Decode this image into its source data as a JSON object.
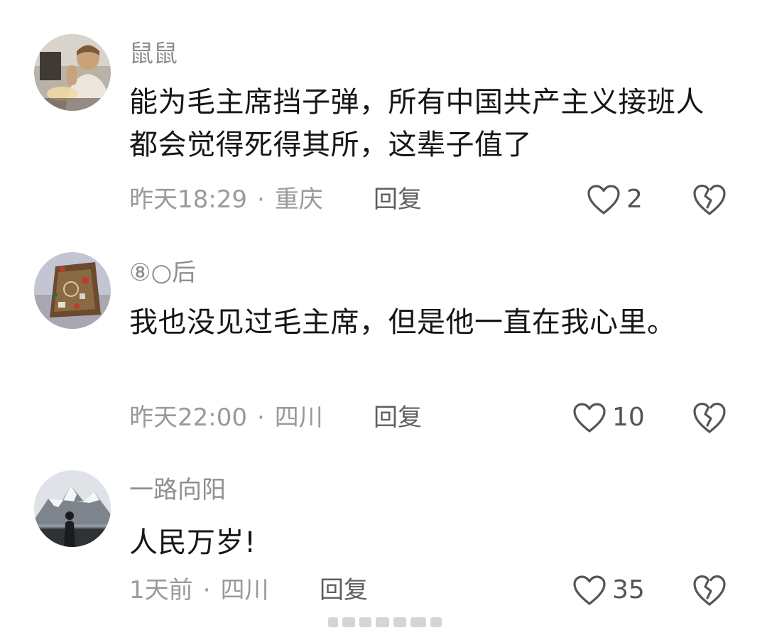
{
  "comments": [
    {
      "username": "鼠鼠",
      "text": "能为毛主席挡子弹，所有中国共产主义接班人都会觉得死得其所，这辈子值了",
      "time": "昨天18:29",
      "separator": "·",
      "location": "重庆",
      "reply_label": "回复",
      "likes": "2"
    },
    {
      "username": "⑧○后",
      "text": "我也没见过毛主席，但是他一直在我心里。",
      "time": "昨天22:00",
      "separator": "·",
      "location": "四川",
      "reply_label": "回复",
      "likes": "10"
    },
    {
      "username": "一路向阳",
      "text": "人民万岁!",
      "time": "1天前",
      "separator": "·",
      "location": "四川",
      "reply_label": "回复",
      "likes": "35"
    }
  ],
  "icons": {
    "like": "heart-outline-icon",
    "dislike": "broken-heart-icon"
  },
  "colors": {
    "username": "#8f8f8f",
    "text": "#161616",
    "meta": "#9a9a9a",
    "icon": "#555555"
  }
}
